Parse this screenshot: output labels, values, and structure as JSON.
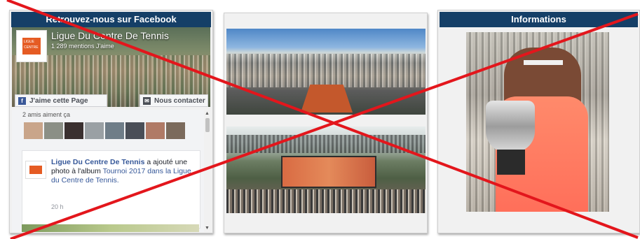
{
  "facebook_panel": {
    "header": "Retrouvez-nous sur Facebook",
    "page_name": "Ligue Du Centre De Tennis",
    "likes": "1 289 mentions J'aime",
    "like_button": "J'aime cette Page",
    "contact_button": "Nous contacter",
    "friends_label": "2 amis aiment ça",
    "post": {
      "author": "Ligue Du Centre De Tennis",
      "text_before": "a ajouté une photo à l'album",
      "album_link": "Tournoi 2017 dans la Ligue du Centre de Tennis.",
      "time": "20 h"
    }
  },
  "info_panel": {
    "header": "Informations"
  },
  "icons": {
    "like": "facebook-f-icon",
    "contact": "messenger-icon",
    "overlay": "red-cross-overlay"
  },
  "colors": {
    "header_bg": "#153f67",
    "cross": "#e3161c",
    "facebook_link": "#365899"
  }
}
